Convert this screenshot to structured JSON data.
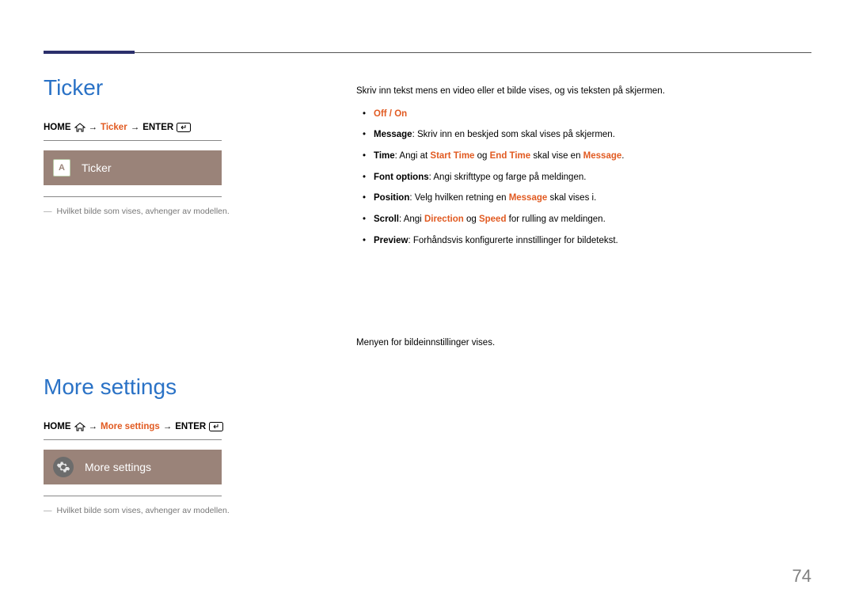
{
  "page_number": "74",
  "ticker": {
    "heading": "Ticker",
    "path": {
      "home": "HOME",
      "target": "Ticker",
      "enter": "ENTER"
    },
    "tile_icon_letter": "A",
    "tile_label": "Ticker",
    "note": "Hvilket bilde som vises, avhenger av modellen.",
    "intro": "Skriv inn tekst mens en video eller et bilde vises, og vis teksten på skjermen.",
    "items": {
      "off_on": "Off / On",
      "message_label": "Message",
      "message_text": ": Skriv inn en beskjed som skal vises på skjermen.",
      "time_label": "Time",
      "time_t1": ": Angi at ",
      "time_start": "Start Time",
      "time_t2": " og ",
      "time_end": "End Time",
      "time_t3": " skal vise en ",
      "time_msg": "Message",
      "time_t4": ".",
      "font_label": "Font options",
      "font_text": ": Angi skrifttype og farge på meldingen.",
      "pos_label": "Position",
      "pos_t1": ": Velg hvilken retning en ",
      "pos_msg": "Message",
      "pos_t2": " skal vises i.",
      "scroll_label": "Scroll",
      "scroll_t1": ": Angi ",
      "scroll_dir": "Direction",
      "scroll_t2": " og ",
      "scroll_spd": "Speed",
      "scroll_t3": " for rulling av meldingen.",
      "preview_label": "Preview",
      "preview_text": ": Forhåndsvis konfigurerte innstillinger for bildetekst."
    }
  },
  "more": {
    "heading": "More settings",
    "path": {
      "home": "HOME",
      "target": "More settings",
      "enter": "ENTER"
    },
    "tile_label": "More settings",
    "note": "Hvilket bilde som vises, avhenger av modellen.",
    "intro": "Menyen for bildeinnstillinger vises."
  }
}
